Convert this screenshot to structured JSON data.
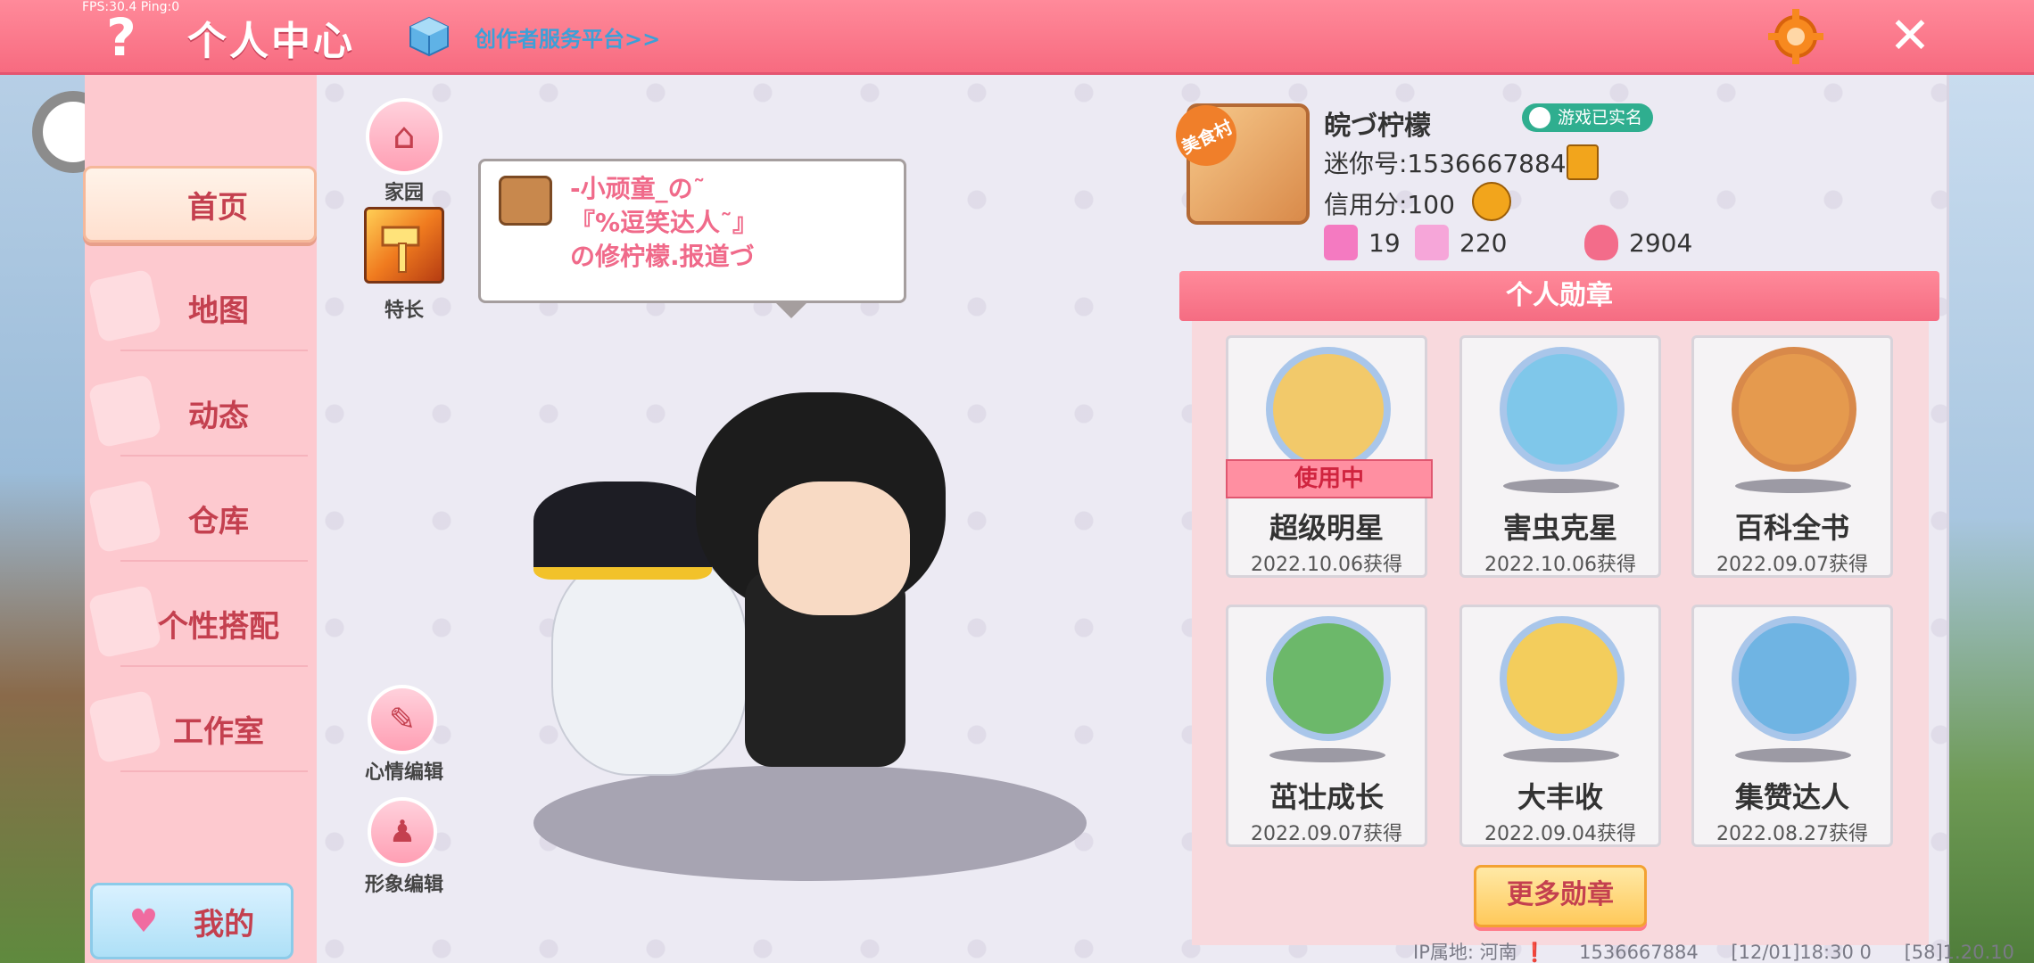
{
  "fps": "FPS:30.4  Ping:0",
  "header": {
    "help_label": "?",
    "title": "个人中心",
    "creator_link": "创作者服务平台>>",
    "close_label": "✕"
  },
  "sidebar": {
    "items": [
      {
        "label": "首页",
        "active": true
      },
      {
        "label": "地图"
      },
      {
        "label": "动态"
      },
      {
        "label": "仓库"
      },
      {
        "label": "个性搭配"
      },
      {
        "label": "工作室"
      }
    ],
    "mine_label": "我的"
  },
  "left_actions": {
    "home": "家园",
    "skill": "特长",
    "mood_edit": "心情编辑",
    "look_edit": "形象编辑"
  },
  "bubble": {
    "text": "-小顽童_の˜\n『%逗笑达人˜』\nの修柠檬.报道づ"
  },
  "profile": {
    "avatar_badge": "美食村",
    "username": "皖づ柠檬",
    "verified": "游戏已实名",
    "mini_id": "迷你号:1536667884",
    "credit": "信用分:100",
    "stats": [
      {
        "value": "19",
        "color": "#f47ac1"
      },
      {
        "value": "220",
        "color": "#f6a6d9"
      },
      {
        "value": "2904",
        "color": "#f36c8a"
      }
    ]
  },
  "medals": {
    "title": "个人勋章",
    "in_use_label": "使用中",
    "items": [
      {
        "name": "超级明星",
        "date": "2022.10.06获得",
        "color": "#f2c96a",
        "in_use": true
      },
      {
        "name": "害虫克星",
        "date": "2022.10.06获得",
        "color": "#7fc7ea"
      },
      {
        "name": "百科全书",
        "date": "2022.09.07获得",
        "color": "#e59a4e"
      },
      {
        "name": "茁壮成长",
        "date": "2022.09.07获得",
        "color": "#6cb86a"
      },
      {
        "name": "大丰收",
        "date": "2022.09.04获得",
        "color": "#f3cd5c"
      },
      {
        "name": "集赞达人",
        "date": "2022.08.27获得",
        "color": "#6fb4e3"
      }
    ],
    "more_label": "更多勋章"
  },
  "footer": {
    "ip": "IP属地: 河南 ❗",
    "id": "1536667884",
    "time": "[12/01]18:30 0",
    "version": "[58]1.20.10"
  }
}
